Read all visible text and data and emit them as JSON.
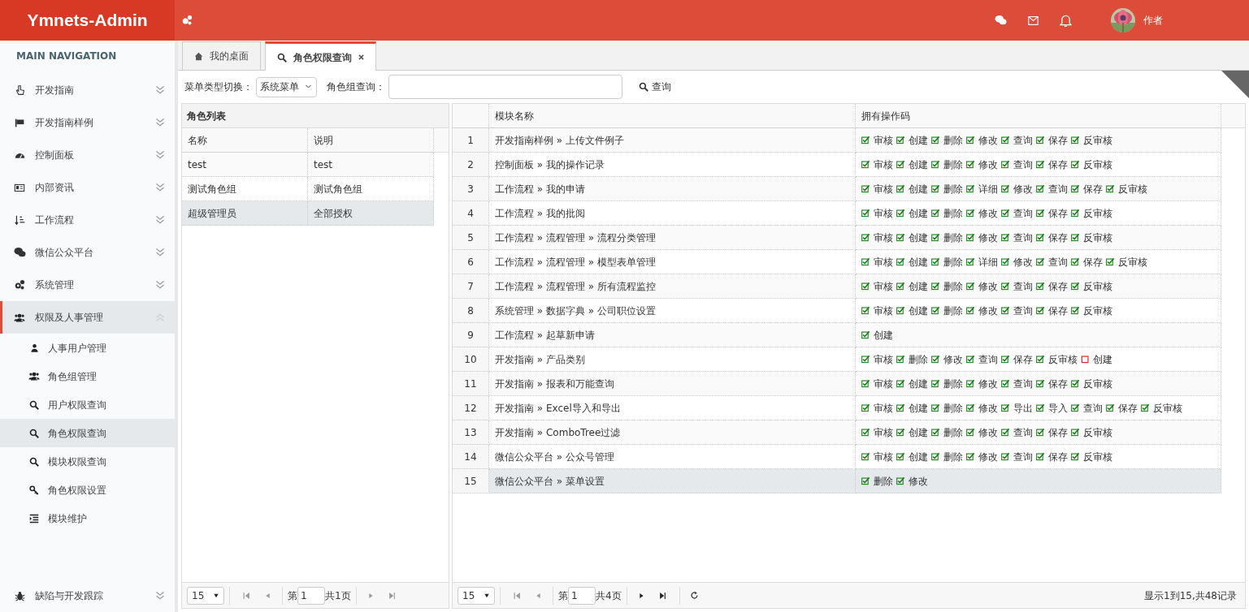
{
  "header": {
    "logo": "Ymnets-Admin",
    "user": "作者"
  },
  "sidebar": {
    "heading": "MAIN NAVIGATION",
    "items": [
      {
        "label": "开发指南",
        "expanded": false
      },
      {
        "label": "开发指南样例",
        "expanded": false
      },
      {
        "label": "控制面板",
        "expanded": false
      },
      {
        "label": "内部资讯",
        "expanded": false
      },
      {
        "label": "工作流程",
        "expanded": false
      },
      {
        "label": "微信公众平台",
        "expanded": false
      },
      {
        "label": "系统管理",
        "expanded": false
      },
      {
        "label": "权限及人事管理",
        "expanded": true,
        "children": [
          {
            "label": "人事用户管理",
            "selected": false
          },
          {
            "label": "角色组管理",
            "selected": false
          },
          {
            "label": "用户权限查询",
            "selected": false
          },
          {
            "label": "角色权限查询",
            "selected": true
          },
          {
            "label": "模块权限查询",
            "selected": false
          },
          {
            "label": "角色权限设置",
            "selected": false
          },
          {
            "label": "模块维护",
            "selected": false
          }
        ]
      },
      {
        "label": "缺陷与开发跟踪",
        "expanded": false
      }
    ]
  },
  "tabs": [
    {
      "label": "我的桌面",
      "selected": false,
      "closable": false
    },
    {
      "label": "角色权限查询",
      "selected": true,
      "closable": true
    }
  ],
  "toolbar": {
    "menu_type_label": "菜单类型切换：",
    "menu_type_value": "系统菜单",
    "group_label": "角色组查询：",
    "search_button": "查询"
  },
  "role_list": {
    "title": "角色列表",
    "columns": [
      "名称",
      "说明"
    ],
    "rows": [
      {
        "cells": [
          "test",
          "test"
        ],
        "selected": false
      },
      {
        "cells": [
          "测试角色组",
          "测试角色组"
        ],
        "selected": false
      },
      {
        "cells": [
          "超级管理员",
          "全部授权"
        ],
        "selected": true
      }
    ],
    "pager": {
      "page_size": "15",
      "page_label": "第",
      "page": "1",
      "total_pages": "共1页"
    }
  },
  "modules": {
    "columns": [
      "模块名称",
      "拥有操作码"
    ],
    "rows": [
      {
        "number": "1",
        "module": "开发指南样例 » 上传文件例子",
        "selected": false,
        "ops": [
          {
            "label": "审核",
            "checked": true
          },
          {
            "label": "创建",
            "checked": true
          },
          {
            "label": "删除",
            "checked": true
          },
          {
            "label": "修改",
            "checked": true
          },
          {
            "label": "查询",
            "checked": true
          },
          {
            "label": "保存",
            "checked": true
          },
          {
            "label": "反审核",
            "checked": true
          }
        ]
      },
      {
        "number": "2",
        "module": "控制面板 » 我的操作记录",
        "selected": false,
        "ops": [
          {
            "label": "审核",
            "checked": true
          },
          {
            "label": "创建",
            "checked": true
          },
          {
            "label": "删除",
            "checked": true
          },
          {
            "label": "修改",
            "checked": true
          },
          {
            "label": "查询",
            "checked": true
          },
          {
            "label": "保存",
            "checked": true
          },
          {
            "label": "反审核",
            "checked": true
          }
        ]
      },
      {
        "number": "3",
        "module": "工作流程 » 我的申请",
        "selected": false,
        "ops": [
          {
            "label": "审核",
            "checked": true
          },
          {
            "label": "创建",
            "checked": true
          },
          {
            "label": "删除",
            "checked": true
          },
          {
            "label": "详细",
            "checked": true
          },
          {
            "label": "修改",
            "checked": true
          },
          {
            "label": "查询",
            "checked": true
          },
          {
            "label": "保存",
            "checked": true
          },
          {
            "label": "反审核",
            "checked": true
          }
        ]
      },
      {
        "number": "4",
        "module": "工作流程 » 我的批阅",
        "selected": false,
        "ops": [
          {
            "label": "审核",
            "checked": true
          },
          {
            "label": "创建",
            "checked": true
          },
          {
            "label": "删除",
            "checked": true
          },
          {
            "label": "修改",
            "checked": true
          },
          {
            "label": "查询",
            "checked": true
          },
          {
            "label": "保存",
            "checked": true
          },
          {
            "label": "反审核",
            "checked": true
          }
        ]
      },
      {
        "number": "5",
        "module": "工作流程 » 流程管理 » 流程分类管理",
        "selected": false,
        "ops": [
          {
            "label": "审核",
            "checked": true
          },
          {
            "label": "创建",
            "checked": true
          },
          {
            "label": "删除",
            "checked": true
          },
          {
            "label": "修改",
            "checked": true
          },
          {
            "label": "查询",
            "checked": true
          },
          {
            "label": "保存",
            "checked": true
          },
          {
            "label": "反审核",
            "checked": true
          }
        ]
      },
      {
        "number": "6",
        "module": "工作流程 » 流程管理 » 模型表单管理",
        "selected": false,
        "ops": [
          {
            "label": "审核",
            "checked": true
          },
          {
            "label": "创建",
            "checked": true
          },
          {
            "label": "删除",
            "checked": true
          },
          {
            "label": "详细",
            "checked": true
          },
          {
            "label": "修改",
            "checked": true
          },
          {
            "label": "查询",
            "checked": true
          },
          {
            "label": "保存",
            "checked": true
          },
          {
            "label": "反审核",
            "checked": true
          }
        ]
      },
      {
        "number": "7",
        "module": "工作流程 » 流程管理 » 所有流程监控",
        "selected": false,
        "ops": [
          {
            "label": "审核",
            "checked": true
          },
          {
            "label": "创建",
            "checked": true
          },
          {
            "label": "删除",
            "checked": true
          },
          {
            "label": "修改",
            "checked": true
          },
          {
            "label": "查询",
            "checked": true
          },
          {
            "label": "保存",
            "checked": true
          },
          {
            "label": "反审核",
            "checked": true
          }
        ]
      },
      {
        "number": "8",
        "module": "系统管理 » 数据字典 » 公司职位设置",
        "selected": false,
        "ops": [
          {
            "label": "审核",
            "checked": true
          },
          {
            "label": "创建",
            "checked": true
          },
          {
            "label": "删除",
            "checked": true
          },
          {
            "label": "修改",
            "checked": true
          },
          {
            "label": "查询",
            "checked": true
          },
          {
            "label": "保存",
            "checked": true
          },
          {
            "label": "反审核",
            "checked": true
          }
        ]
      },
      {
        "number": "9",
        "module": "工作流程 » 起草新申请",
        "selected": false,
        "ops": [
          {
            "label": "创建",
            "checked": true
          }
        ]
      },
      {
        "number": "10",
        "module": "开发指南 » 产品类别",
        "selected": false,
        "ops": [
          {
            "label": "审核",
            "checked": true
          },
          {
            "label": "删除",
            "checked": true
          },
          {
            "label": "修改",
            "checked": true
          },
          {
            "label": "查询",
            "checked": true
          },
          {
            "label": "保存",
            "checked": true
          },
          {
            "label": "反审核",
            "checked": true
          },
          {
            "label": "创建",
            "checked": false
          }
        ]
      },
      {
        "number": "11",
        "module": "开发指南 » 报表和万能查询",
        "selected": false,
        "ops": [
          {
            "label": "审核",
            "checked": true
          },
          {
            "label": "创建",
            "checked": true
          },
          {
            "label": "删除",
            "checked": true
          },
          {
            "label": "修改",
            "checked": true
          },
          {
            "label": "查询",
            "checked": true
          },
          {
            "label": "保存",
            "checked": true
          },
          {
            "label": "反审核",
            "checked": true
          }
        ]
      },
      {
        "number": "12",
        "module": "开发指南 » Excel导入和导出",
        "selected": false,
        "ops": [
          {
            "label": "审核",
            "checked": true
          },
          {
            "label": "创建",
            "checked": true
          },
          {
            "label": "删除",
            "checked": true
          },
          {
            "label": "修改",
            "checked": true
          },
          {
            "label": "导出",
            "checked": true
          },
          {
            "label": "导入",
            "checked": true
          },
          {
            "label": "查询",
            "checked": true
          },
          {
            "label": "保存",
            "checked": true
          },
          {
            "label": "反审核",
            "checked": true
          }
        ]
      },
      {
        "number": "13",
        "module": "开发指南 » ComboTree过滤",
        "selected": false,
        "ops": [
          {
            "label": "审核",
            "checked": true
          },
          {
            "label": "创建",
            "checked": true
          },
          {
            "label": "删除",
            "checked": true
          },
          {
            "label": "修改",
            "checked": true
          },
          {
            "label": "查询",
            "checked": true
          },
          {
            "label": "保存",
            "checked": true
          },
          {
            "label": "反审核",
            "checked": true
          }
        ]
      },
      {
        "number": "14",
        "module": "微信公众平台 » 公众号管理",
        "selected": false,
        "ops": [
          {
            "label": "审核",
            "checked": true
          },
          {
            "label": "创建",
            "checked": true
          },
          {
            "label": "删除",
            "checked": true
          },
          {
            "label": "修改",
            "checked": true
          },
          {
            "label": "查询",
            "checked": true
          },
          {
            "label": "保存",
            "checked": true
          },
          {
            "label": "反审核",
            "checked": true
          }
        ]
      },
      {
        "number": "15",
        "module": "微信公众平台 » 菜单设置",
        "selected": true,
        "ops": [
          {
            "label": "删除",
            "checked": true
          },
          {
            "label": "修改",
            "checked": true
          }
        ]
      }
    ],
    "pager": {
      "page_size": "15",
      "page_label": "第",
      "page": "1",
      "total_pages": "共4页",
      "summary": "显示1到15,共48记录"
    }
  }
}
